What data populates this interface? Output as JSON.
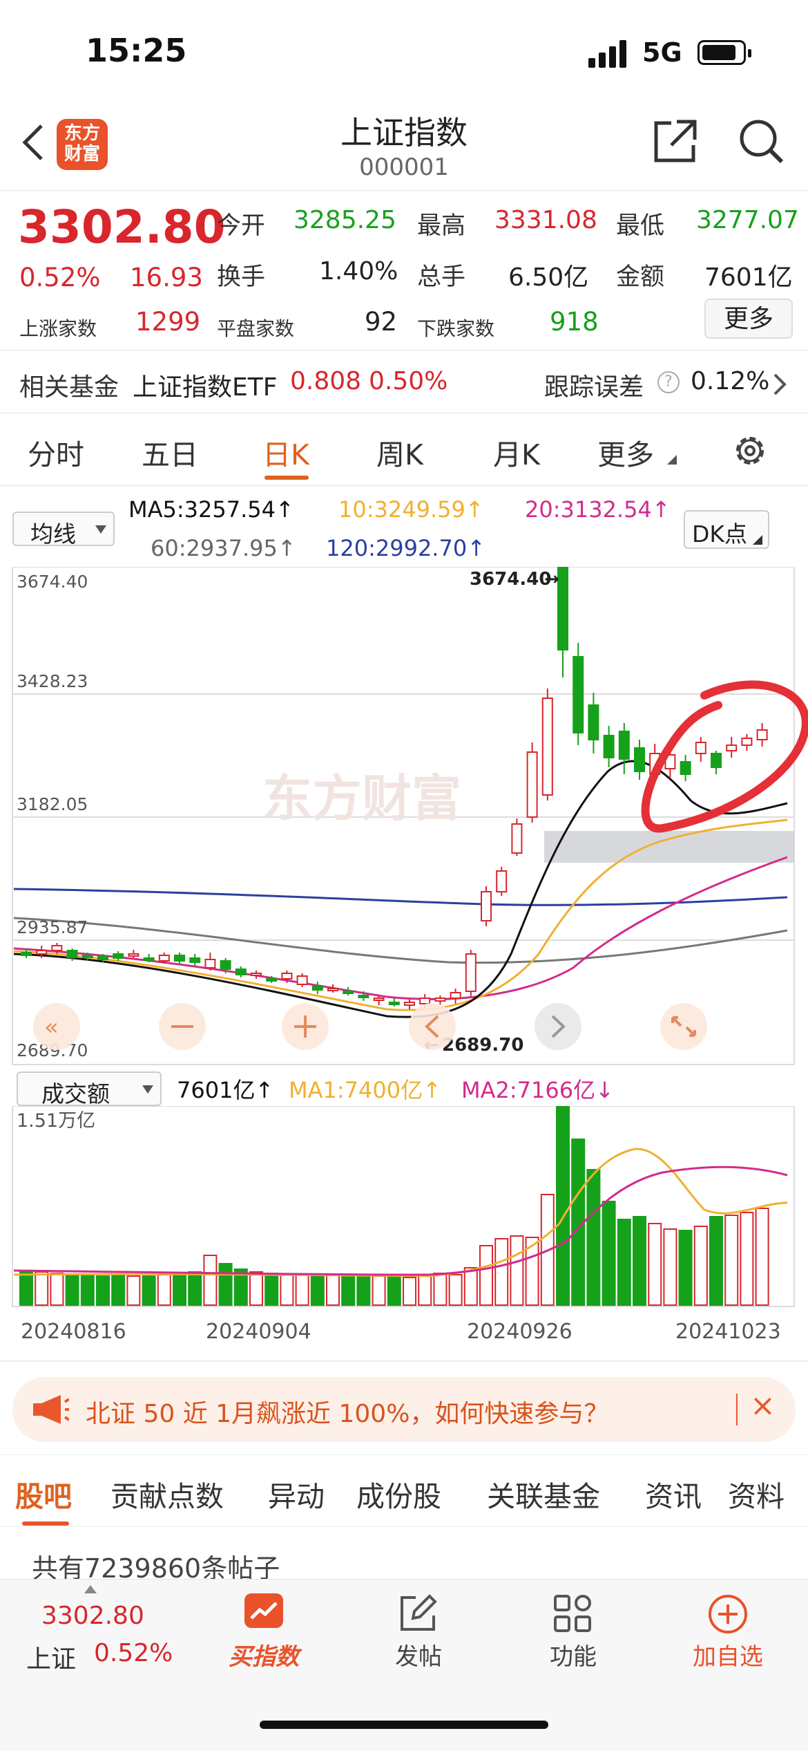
{
  "status_bar": {
    "time": "15:25",
    "network": "5G"
  },
  "header": {
    "title": "上证指数",
    "code": "000001",
    "logo_text": "东方财富"
  },
  "quote": {
    "price": "3302.80",
    "change_pct": "0.52%",
    "change": "16.93",
    "open_label": "今开",
    "open": "3285.25",
    "high_label": "最高",
    "high": "3331.08",
    "low_label": "最低",
    "low": "3277.07",
    "turnover_label": "换手",
    "turnover": "1.40%",
    "volume_label": "总手",
    "volume": "6.50亿",
    "amount_label": "金额",
    "amount": "7601亿",
    "up_label": "上涨家数",
    "up_count": "1299",
    "flat_label": "平盘家数",
    "flat_count": "92",
    "down_label": "下跌家数",
    "down_count": "918",
    "more_label": "更多"
  },
  "fund": {
    "label": "相关基金",
    "name": "上证指数ETF",
    "price": "0.808",
    "change": "0.50%",
    "error_label": "跟踪误差",
    "error_value": "0.12%"
  },
  "period_tabs": [
    "分时",
    "五日",
    "日K",
    "周K",
    "月K",
    "更多"
  ],
  "active_tab": "日K",
  "ma_selector": "均线",
  "ma": {
    "ma5": "MA5:3257.54↑",
    "ma10": "10:3249.59↑",
    "ma20": "20:3132.54↑",
    "ma60": "60:2937.95↑",
    "ma120": "120:2992.70↑"
  },
  "dk_button": "DK点",
  "watermark": "东方财富",
  "chart_data": {
    "type": "candlestick",
    "y_ticks": [
      "3674.40",
      "3428.23",
      "3182.05",
      "2935.87",
      "2689.70"
    ],
    "high_annotation": "3674.40",
    "low_annotation": "2689.70",
    "x_ticks": [
      "20240816",
      "20240904",
      "20240926",
      "20241023"
    ],
    "volume_label": "1.51万亿",
    "volume_indicator": "成交额",
    "volume_value": "7601亿↑",
    "volume_ma1": "MA1:7400亿↑",
    "volume_ma2": "MA2:7166亿↓",
    "colors": {
      "up": "#d8262c",
      "down": "#16a11b",
      "ma5": "#111111",
      "ma10": "#f0b030",
      "ma20": "#d42a8c",
      "ma60": "#777777",
      "ma120": "#2b3fa0"
    }
  },
  "banner": {
    "text": "北证 50 近 1月飙涨近 100%，如何快速参与？"
  },
  "content_tabs": [
    "股吧",
    "贡献点数",
    "异动",
    "成份股",
    "关联基金",
    "资讯",
    "资料"
  ],
  "post_count": "共有7239860条帖子",
  "bottom_nav": {
    "index_price": "3302.80",
    "index_name": "上证",
    "index_change": "0.52%",
    "buy": "买指数",
    "post": "发帖",
    "function": "功能",
    "watch": "加自选"
  }
}
